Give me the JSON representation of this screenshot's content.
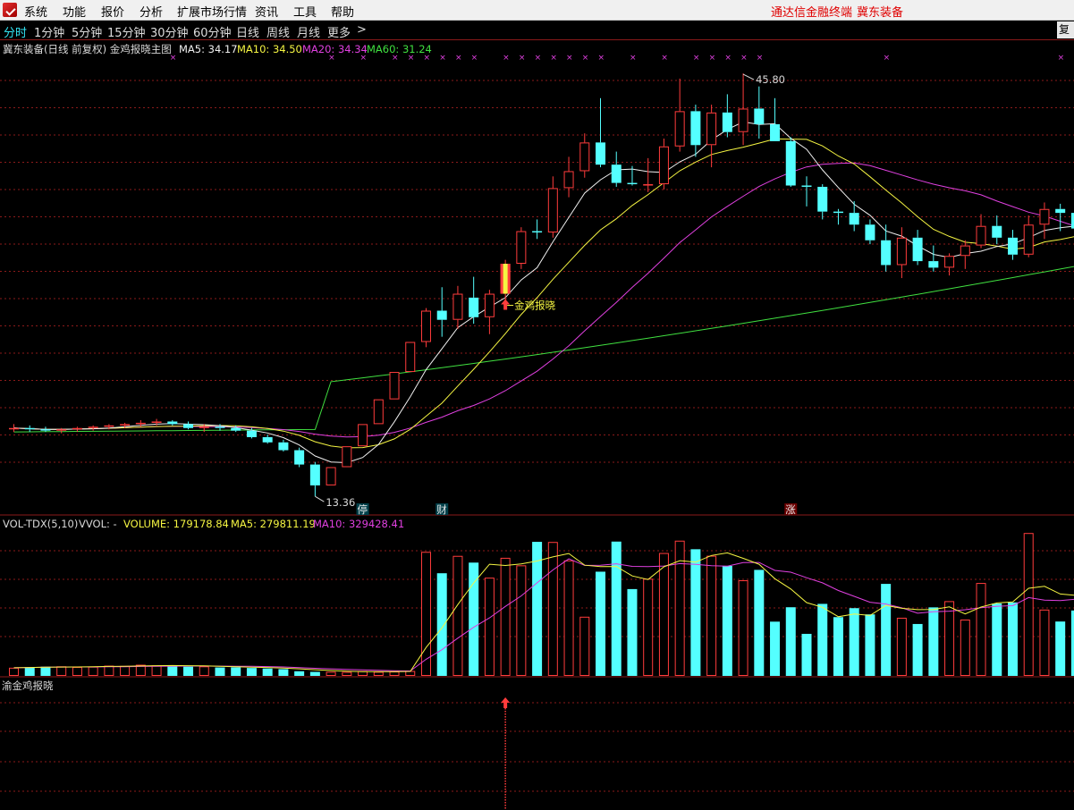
{
  "menu": {
    "items": [
      "系统",
      "功能",
      "报价",
      "分析",
      "扩展市场行情",
      "资讯",
      "工具",
      "帮助"
    ],
    "right_links": [
      "通达信金融终端",
      "冀东装备"
    ]
  },
  "periods": {
    "items": [
      "分时",
      "1分钟",
      "5分钟",
      "15分钟",
      "30分钟",
      "60分钟",
      "日线",
      "周线",
      "月线",
      "更多"
    ],
    "more_arrow": ">",
    "active_index": 0,
    "restore_label": "复权"
  },
  "main_legend": {
    "title": "冀东装备(日线 前复权) 金鸡报晓主图",
    "items": [
      {
        "label": "MA5: 34.17",
        "color": "#f0f0f0"
      },
      {
        "label": "MA10: 34.50",
        "color": "#f5f542"
      },
      {
        "label": "MA20: 34.34",
        "color": "#e040e0"
      },
      {
        "label": "MA60: 31.24",
        "color": "#40e040"
      }
    ]
  },
  "vol_legend": {
    "title": "VOL-TDX(5,10)",
    "wvol": "VVOL: -",
    "items": [
      {
        "label": "VOLUME: 179178.84",
        "color": "#f5f542"
      },
      {
        "label": "MA5: 279811.19",
        "color": "#f5f542"
      },
      {
        "label": "MA10: 329428.41",
        "color": "#e040e0"
      }
    ]
  },
  "sub_legend": {
    "title": "渝金鸡报晓"
  },
  "annotations": {
    "high_label": "45.80",
    "low_label": "13.36",
    "signal_label": "金鸡报晓",
    "markers": [
      {
        "candle": 22,
        "text": "停"
      },
      {
        "candle": 27,
        "text": "财"
      },
      {
        "candle": 49,
        "text": "涨"
      }
    ],
    "cross_glyph": "×"
  },
  "colors": {
    "up": "#ff3c3c",
    "down": "#54ffff",
    "ma5": "#f0f0f0",
    "ma10": "#f5f542",
    "ma20": "#e040e0",
    "ma60": "#40e040",
    "grid": "#8b1a1a",
    "cross": "#e040e0",
    "signal": "#ff3c3c",
    "signal_bar": "#f5f542"
  },
  "chart_data": {
    "type": "candlestick",
    "ylim": [
      12,
      48
    ],
    "candles": [
      [
        18.6,
        18.9,
        18.3,
        18.6
      ],
      [
        18.6,
        18.8,
        18.3,
        18.5
      ],
      [
        18.5,
        18.7,
        18.3,
        18.4
      ],
      [
        18.4,
        18.6,
        18.2,
        18.5
      ],
      [
        18.5,
        18.7,
        18.3,
        18.6
      ],
      [
        18.6,
        18.8,
        18.4,
        18.7
      ],
      [
        18.7,
        18.9,
        18.5,
        18.8
      ],
      [
        18.8,
        19.0,
        18.6,
        18.9
      ],
      [
        18.9,
        19.2,
        18.7,
        19.0
      ],
      [
        19.0,
        19.3,
        18.8,
        19.1
      ],
      [
        19.1,
        19.2,
        18.8,
        18.9
      ],
      [
        18.9,
        19.1,
        18.5,
        18.6
      ],
      [
        18.6,
        18.9,
        18.3,
        18.7
      ],
      [
        18.7,
        18.9,
        18.4,
        18.6
      ],
      [
        18.6,
        18.8,
        18.3,
        18.4
      ],
      [
        18.4,
        18.6,
        17.8,
        17.9
      ],
      [
        17.9,
        18.1,
        17.4,
        17.5
      ],
      [
        17.5,
        17.7,
        16.8,
        16.9
      ],
      [
        16.9,
        17.1,
        15.6,
        15.8
      ],
      [
        15.8,
        16.0,
        13.36,
        14.2
      ],
      [
        14.2,
        15.6,
        14.2,
        15.6
      ],
      [
        15.6,
        17.2,
        15.6,
        17.2
      ],
      [
        17.2,
        18.9,
        17.2,
        18.9
      ],
      [
        18.9,
        20.8,
        18.9,
        20.8
      ],
      [
        20.8,
        22.9,
        20.8,
        22.9
      ],
      [
        22.9,
        25.2,
        22.9,
        25.2
      ],
      [
        25.2,
        27.8,
        24.8,
        27.6
      ],
      [
        27.6,
        29.4,
        25.6,
        26.9
      ],
      [
        26.9,
        29.5,
        26.2,
        28.9
      ],
      [
        28.6,
        30.2,
        26.6,
        27.1
      ],
      [
        27.1,
        29.2,
        25.8,
        28.9
      ],
      [
        28.9,
        31.5,
        28.3,
        31.2
      ],
      [
        31.2,
        34.0,
        30.8,
        33.7
      ],
      [
        33.7,
        34.6,
        33.1,
        33.6
      ],
      [
        33.6,
        37.9,
        33.2,
        37.0
      ],
      [
        37.0,
        39.4,
        36.3,
        38.3
      ],
      [
        38.3,
        41.2,
        37.8,
        40.5
      ],
      [
        40.5,
        43.9,
        38.6,
        38.8
      ],
      [
        38.8,
        39.8,
        37.1,
        37.4
      ],
      [
        37.4,
        38.7,
        37.2,
        37.3
      ],
      [
        37.3,
        39.3,
        36.7,
        37.3
      ],
      [
        37.3,
        40.8,
        36.9,
        40.2
      ],
      [
        40.2,
        45.4,
        39.8,
        42.9
      ],
      [
        42.9,
        43.4,
        39.4,
        40.3
      ],
      [
        40.3,
        43.4,
        38.6,
        42.8
      ],
      [
        42.8,
        44.2,
        40.9,
        41.3
      ],
      [
        41.3,
        45.8,
        40.3,
        43.1
      ],
      [
        43.1,
        44.8,
        40.8,
        41.9
      ],
      [
        41.9,
        43.9,
        40.6,
        40.6
      ],
      [
        40.6,
        40.9,
        37.1,
        37.2
      ],
      [
        37.2,
        37.9,
        35.6,
        37.1
      ],
      [
        37.1,
        37.3,
        34.6,
        35.2
      ],
      [
        35.2,
        35.4,
        34.2,
        35.1
      ],
      [
        35.1,
        36.0,
        33.7,
        34.2
      ],
      [
        34.2,
        34.6,
        32.7,
        33.0
      ],
      [
        33.0,
        34.2,
        30.6,
        31.1
      ],
      [
        31.1,
        34.0,
        30.1,
        33.2
      ],
      [
        33.2,
        33.8,
        31.1,
        31.4
      ],
      [
        31.4,
        32.6,
        30.6,
        30.9
      ],
      [
        30.9,
        32.0,
        30.3,
        31.8
      ],
      [
        31.8,
        33.0,
        30.8,
        32.6
      ],
      [
        32.6,
        35.0,
        32.4,
        34.1
      ],
      [
        34.1,
        34.9,
        32.7,
        33.2
      ],
      [
        33.2,
        33.8,
        31.5,
        31.9
      ],
      [
        31.9,
        34.9,
        31.7,
        34.2
      ],
      [
        34.2,
        35.9,
        33.1,
        35.4
      ],
      [
        35.4,
        35.8,
        33.7,
        35.1
      ],
      [
        35.1,
        35.9,
        33.6,
        33.9
      ],
      [
        33.9,
        34.6,
        33.3,
        34.3
      ]
    ],
    "volume": [
      6.3,
      6.6,
      7.1,
      7.4,
      6.9,
      7.1,
      7.9,
      7.7,
      8.6,
      8.1,
      7.6,
      7.1,
      7.4,
      6.5,
      6.6,
      6.1,
      5.7,
      5.2,
      3.6,
      3.1,
      3.2,
      3.1,
      3.7,
      3.2,
      3.4,
      3.8,
      95.6,
      79.1,
      92.5,
      87.3,
      75.7,
      91.0,
      85.2,
      103.3,
      103.2,
      89.0,
      45.6,
      80.3,
      103.5,
      66.9,
      74.9,
      94.7,
      104.2,
      97.6,
      92.6,
      84.8,
      73.7,
      81.7,
      41.8,
      52.9,
      32.4,
      55.5,
      45.3,
      52.2,
      47.4,
      70.9,
      44.8,
      40.0,
      52.8,
      57.6,
      43.4,
      71.6,
      55.8,
      56.6,
      110.1,
      51.1,
      41.9,
      50.4,
      46.8
    ],
    "ma60_start": 20.0,
    "ma60_end": 31.24
  }
}
